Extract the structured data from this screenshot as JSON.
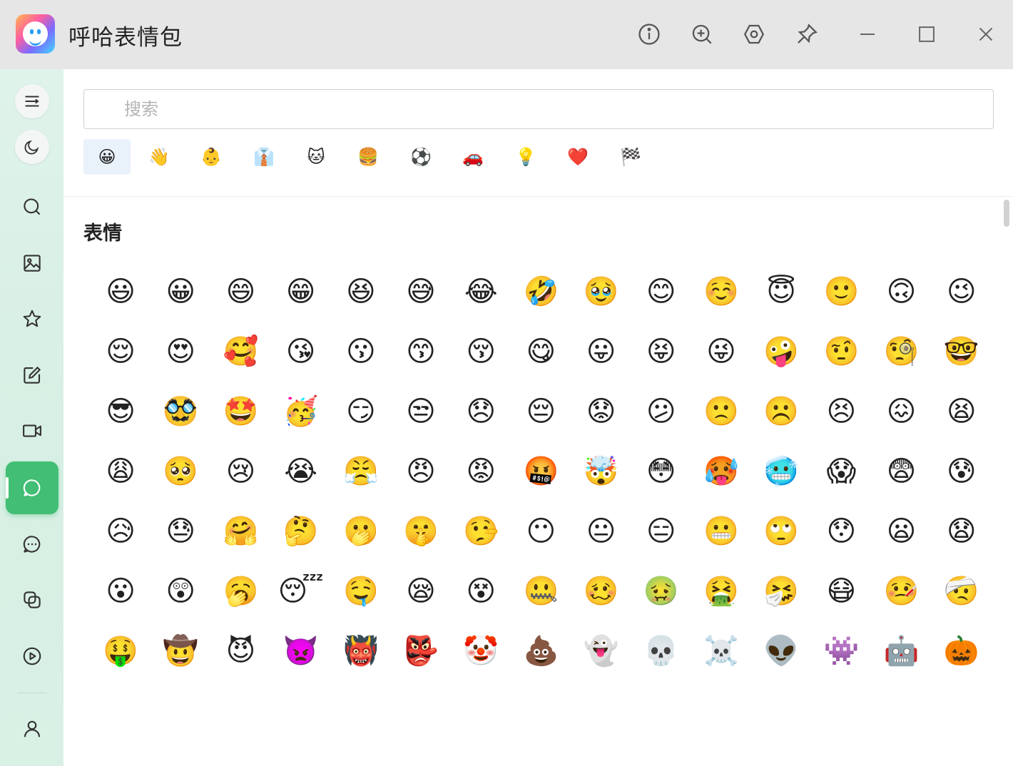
{
  "window": {
    "title": "呼哈表情包",
    "buttons": [
      {
        "name": "info-icon"
      },
      {
        "name": "zoom-in-icon"
      },
      {
        "name": "settings-icon"
      },
      {
        "name": "pin-icon"
      },
      {
        "name": "minimize-icon"
      },
      {
        "name": "maximize-icon"
      },
      {
        "name": "close-icon"
      }
    ]
  },
  "sidebar": {
    "items": [
      {
        "name": "menu-icon"
      },
      {
        "name": "dark-mode-icon"
      },
      {
        "name": "search-icon"
      },
      {
        "name": "image-icon"
      },
      {
        "name": "star-icon"
      },
      {
        "name": "edit-icon"
      },
      {
        "name": "video-icon"
      },
      {
        "name": "chat-icon",
        "active": true
      },
      {
        "name": "comment-icon"
      },
      {
        "name": "copy-icon"
      },
      {
        "name": "play-icon"
      },
      {
        "name": "user-icon"
      }
    ],
    "accent_color": "#42be75"
  },
  "search": {
    "placeholder": "搜索",
    "value": ""
  },
  "categories": [
    "😀",
    "👋",
    "👶",
    "👔",
    "🐱",
    "🍔",
    "⚽",
    "🚗",
    "💡",
    "❤️",
    "🏁"
  ],
  "active_category": 0,
  "section": {
    "title": "表情"
  },
  "emojis": [
    "😃",
    "😀",
    "😄",
    "😁",
    "😆",
    "😅",
    "😂",
    "🤣",
    "🥹",
    "😊",
    "☺️",
    "😇",
    "🙂",
    "🙃",
    "😉",
    "😌",
    "😍",
    "🥰",
    "😘",
    "😗",
    "😙",
    "😚",
    "😋",
    "😛",
    "😝",
    "😜",
    "🤪",
    "🤨",
    "🧐",
    "🤓",
    "😎",
    "🥸",
    "🤩",
    "🥳",
    "😏",
    "😒",
    "😞",
    "😔",
    "😟",
    "😕",
    "🙁",
    "☹️",
    "😣",
    "😖",
    "😫",
    "😩",
    "🥺",
    "😢",
    "😭",
    "😤",
    "😠",
    "😡",
    "🤬",
    "🤯",
    "😳",
    "🥵",
    "🥶",
    "😱",
    "😨",
    "😰",
    "😥",
    "😓",
    "🤗",
    "🤔",
    "🫢",
    "🤫",
    "🤥",
    "😶",
    "😐",
    "😑",
    "😬",
    "🙄",
    "😯",
    "😦",
    "😧",
    "😮",
    "😲",
    "🥱",
    "😴",
    "🤤",
    "😪",
    "😵",
    "🤐",
    "🥴",
    "🤢",
    "🤮",
    "🤧",
    "😷",
    "🤒",
    "🤕",
    "🤑",
    "🤠",
    "😈",
    "👿",
    "👹",
    "👺",
    "🤡",
    "💩",
    "👻",
    "💀",
    "☠️",
    "👽",
    "👾",
    "🤖",
    "🎃"
  ]
}
